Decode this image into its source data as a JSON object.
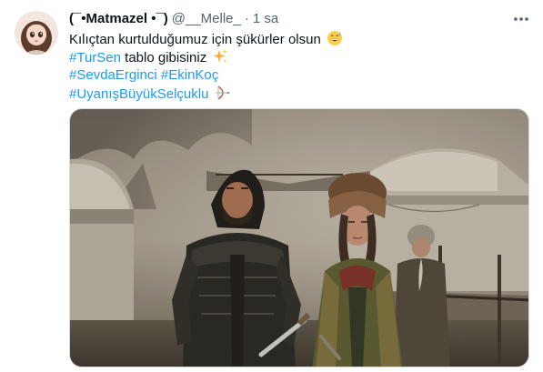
{
  "tweet": {
    "display_name": "(¯•Matmazel •¯)",
    "handle": "@__Melle_",
    "separator": "·",
    "time": "1 sa",
    "lines": {
      "l1": {
        "text": "Kılıçtan kurtulduğumuz için şükürler olsun",
        "emoji": "grinning-sweat-emoji"
      },
      "l2": {
        "hashtag": "#TurSen",
        "text": " tablo gibisiniz",
        "emoji": "sparkles-emoji"
      },
      "l3": {
        "hashtag1": "#SevdaErginci",
        "space": " ",
        "hashtag2": "#EkinKoç"
      },
      "l4": {
        "hashtag": "#UyanışBüyükSelçuklu",
        "emoji": "bow-and-arrow-emoji"
      }
    },
    "media": {
      "type": "photo",
      "description_icon": "tweet-photo"
    }
  },
  "colors": {
    "link": "#1d9bf0",
    "secondary_text": "#536471",
    "primary_text": "#0f1419",
    "border": "#cfd9de"
  }
}
